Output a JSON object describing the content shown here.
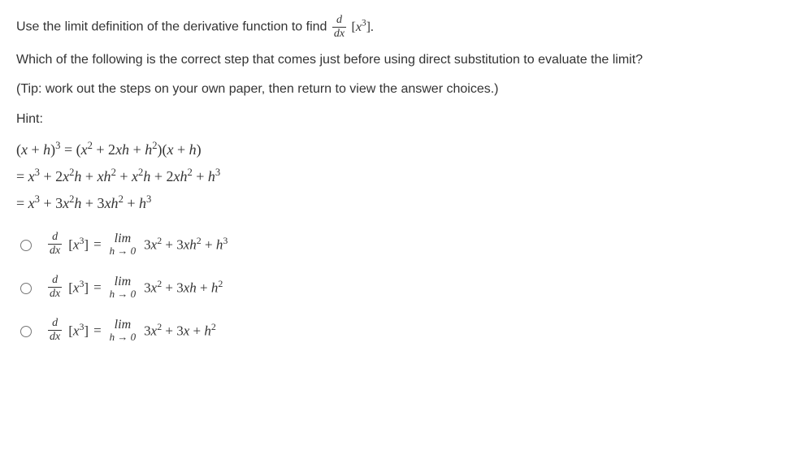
{
  "intro": {
    "pre": "Use the limit definition of the derivative function to find ",
    "frac_num": "d",
    "frac_den": "dx",
    "bracket": "[x³].",
    "q": "Which of the following is the correct step that comes just before using direct substitution to evaluate the limit?",
    "tip": "(Tip: work out the steps on your own paper, then return to view the answer choices.)",
    "hint_label": "Hint:"
  },
  "hint": {
    "l1_lhs": "(x + h)³ = (x² + 2xh + h²)(x + h)",
    "l2": "= x³ + 2x²h + xh² + x²h + 2xh² + h³",
    "l3": "= x³ + 3x²h + 3xh² + h³"
  },
  "shared": {
    "lhs_frac_num": "d",
    "lhs_frac_den": "dx",
    "lhs_bracket": "[x³]",
    "eq": "=",
    "lim_top": "lim",
    "lim_bot": "h → 0"
  },
  "choices": [
    {
      "rhs": "3x² + 3xh² + h³"
    },
    {
      "rhs": "3x² + 3xh + h²"
    },
    {
      "rhs": "3x² + 3x + h²"
    }
  ]
}
